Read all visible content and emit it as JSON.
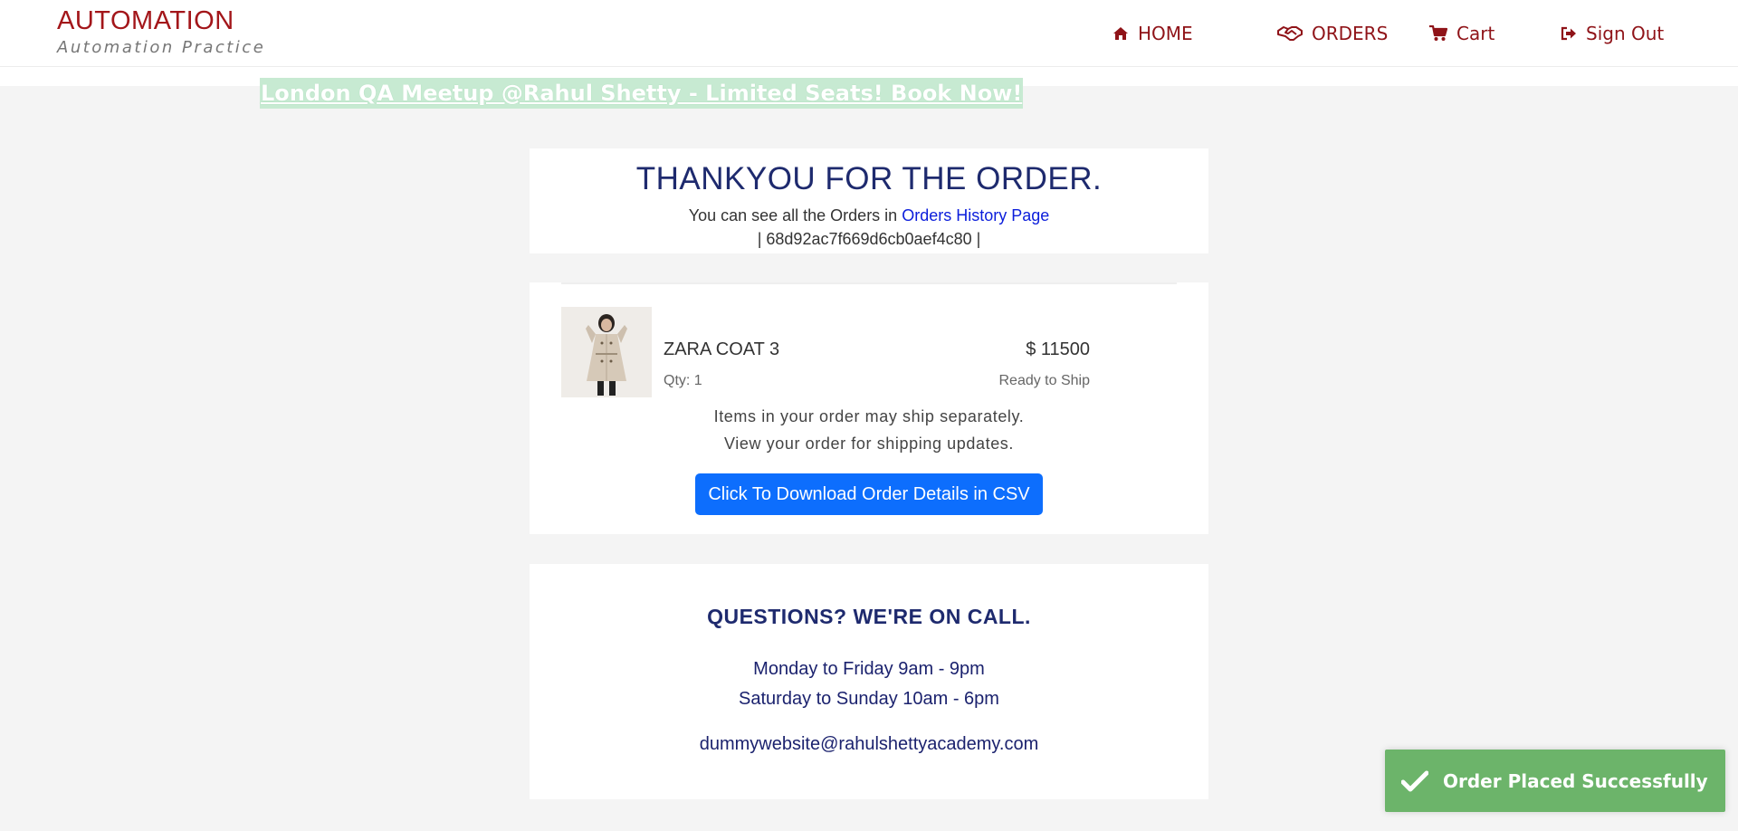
{
  "header": {
    "logo_title": "AUTOMATION",
    "logo_subtitle": "Automation Practice",
    "nav": {
      "home": "HOME",
      "orders": "ORDERS",
      "cart": "Cart",
      "sign_out": "Sign Out"
    }
  },
  "banner": {
    "text": "London QA Meetup @Rahul Shetty - Limited Seats! Book Now!"
  },
  "thanks": {
    "title": "THANKYOU FOR THE ORDER.",
    "history_prefix": "You can see all the Orders in",
    "history_link": "Orders History Page",
    "order_id_line": "| 68d92ac7f669d6cb0aef4c80 |"
  },
  "order": {
    "product_name": "ZARA COAT 3",
    "price": "$ 11500",
    "quantity": "Qty: 1",
    "status": "Ready to Ship",
    "ship_note_1": "Items in your order may ship separately.",
    "ship_note_2": "View your order for shipping updates.",
    "download_button": "Click To Download Order Details in CSV"
  },
  "contact": {
    "title": "QUESTIONS? WE'RE ON CALL.",
    "hours_weekday": "Monday to Friday 9am - 9pm",
    "hours_weekend": "Saturday to Sunday 10am - 6pm",
    "email": "dummywebsite@rahulshettyacademy.com"
  },
  "toast": {
    "message": "Order Placed Successfully"
  },
  "colors": {
    "brand_red": "#a3161a",
    "navy": "#1e2a6e",
    "primary_button": "#0d6efd",
    "success_toast": "#6cb46a"
  }
}
